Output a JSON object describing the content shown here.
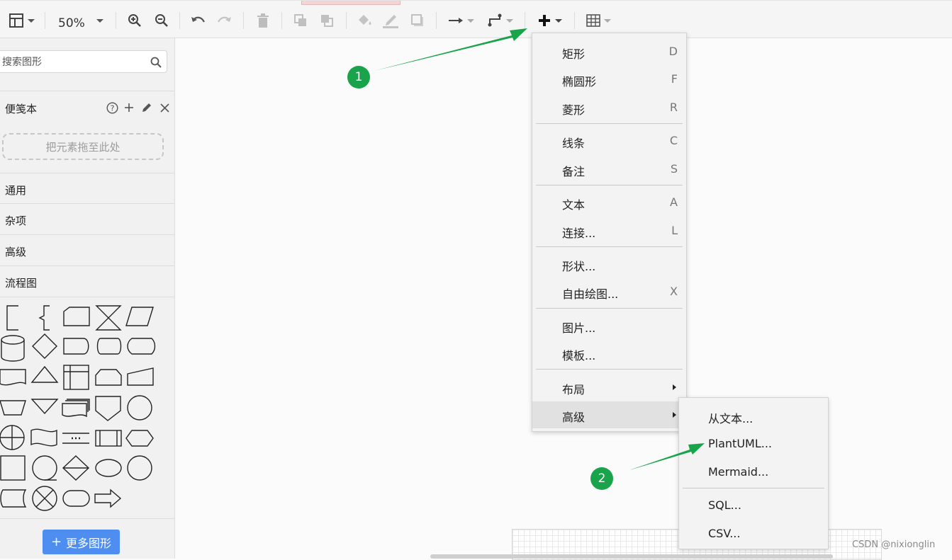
{
  "toolbar": {
    "zoom": "50%",
    "icons": [
      "panel-layout-icon",
      "zoom-in-icon",
      "zoom-out-icon",
      "undo-icon",
      "redo-icon",
      "delete-icon",
      "to-front-icon",
      "to-back-icon",
      "fill-color-icon",
      "line-color-icon",
      "shadow-icon",
      "connection-icon",
      "waypoints-icon",
      "insert-plus-icon",
      "table-icon"
    ]
  },
  "sidebar": {
    "search_placeholder": "搜索图形",
    "scratchpad": {
      "title": "便笺本",
      "drop_hint": "把元素拖至此处"
    },
    "categories": [
      "通用",
      "杂项",
      "高级",
      "流程图"
    ],
    "more_shapes": "更多图形"
  },
  "insert_menu": {
    "items": [
      {
        "label": "矩形",
        "shortcut": "D"
      },
      {
        "label": "椭圆形",
        "shortcut": "F"
      },
      {
        "label": "菱形",
        "shortcut": "R"
      },
      {
        "label": "线条",
        "shortcut": "C"
      },
      {
        "label": "备注",
        "shortcut": "S"
      },
      {
        "label": "文本",
        "shortcut": "A"
      },
      {
        "label": "连接...",
        "shortcut": "L"
      },
      {
        "label": "形状...",
        "shortcut": ""
      },
      {
        "label": "自由绘图...",
        "shortcut": "X"
      },
      {
        "label": "图片...",
        "shortcut": ""
      },
      {
        "label": "模板...",
        "shortcut": ""
      },
      {
        "label": "布局",
        "shortcut": ""
      },
      {
        "label": "高级",
        "shortcut": ""
      }
    ]
  },
  "advanced_submenu": {
    "items": [
      "从文本...",
      "PlantUML...",
      "Mermaid...",
      "SQL...",
      "CSV..."
    ]
  },
  "annotations": {
    "badge_1": "1",
    "badge_2": "2",
    "color": "#19a34a"
  },
  "watermark": "CSDN @nixionglin"
}
